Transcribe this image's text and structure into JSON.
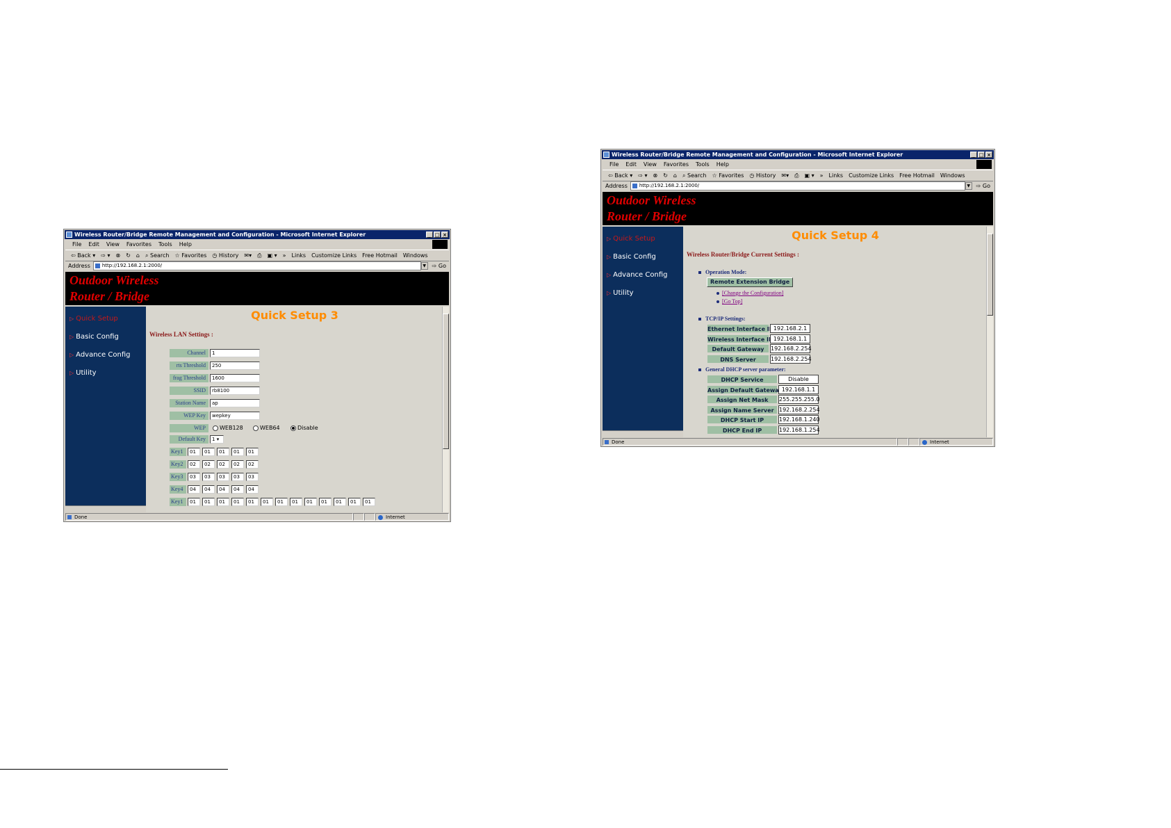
{
  "left_window": {
    "title": "Wireless Router/Bridge Remote Management and Configuration - Microsoft Internet Explorer",
    "menu": [
      "File",
      "Edit",
      "View",
      "Favorites",
      "Tools",
      "Help"
    ],
    "toolbar": [
      "Back",
      "Search",
      "Favorites",
      "History",
      "»",
      "Links",
      "Customize Links",
      "Free Hotmail",
      "Windows"
    ],
    "address_label": "Address",
    "address": "http://192.168.2.1:2000/",
    "go": "Go",
    "banner": [
      "Outdoor Wireless",
      "Router / Bridge"
    ],
    "nav": [
      "Quick Setup",
      "Basic Config",
      "Advance Config",
      "Utility"
    ],
    "page_title": "Quick Setup 3",
    "section": "Wireless LAN Settings :",
    "form": [
      {
        "label": "Channel",
        "value": "1"
      },
      {
        "label": "rts Threshold",
        "value": "250"
      },
      {
        "label": "frag Threshold",
        "value": "1600"
      },
      {
        "label": "SSID",
        "value": "rb8100"
      },
      {
        "label": "Station Name",
        "value": "ap"
      },
      {
        "label": "WEP Key",
        "value": "wepkey"
      }
    ],
    "wep_label": "WEP",
    "wep_options": [
      "WEB128",
      "WEB64",
      "Disable"
    ],
    "wep_selected": "Disable",
    "default_key_label": "Default Key",
    "default_key_value": "1",
    "keys": [
      {
        "label": "Key1",
        "values": [
          "01",
          "01",
          "01",
          "01",
          "01"
        ]
      },
      {
        "label": "Key2",
        "values": [
          "02",
          "02",
          "02",
          "02",
          "02"
        ]
      },
      {
        "label": "Key3",
        "values": [
          "03",
          "03",
          "03",
          "03",
          "03"
        ]
      },
      {
        "label": "Key4",
        "values": [
          "04",
          "04",
          "04",
          "04",
          "04"
        ]
      },
      {
        "label": "Key1",
        "values": [
          "01",
          "01",
          "01",
          "01",
          "01",
          "01",
          "01",
          "01",
          "01",
          "01",
          "01",
          "01",
          "01"
        ]
      }
    ],
    "status": "Done",
    "zone": "Internet"
  },
  "right_window": {
    "title": "Wireless Router/Bridge Remote Management and Configuration - Microsoft Internet Explorer",
    "menu": [
      "File",
      "Edit",
      "View",
      "Favorites",
      "Tools",
      "Help"
    ],
    "toolbar": [
      "Back",
      "Search",
      "Favorites",
      "History",
      "»",
      "Links",
      "Customize Links",
      "Free Hotmail",
      "Windows"
    ],
    "address_label": "Address",
    "address": "http://192.168.2.1:2000/",
    "go": "Go",
    "banner": [
      "Outdoor Wireless",
      "Router / Bridge"
    ],
    "nav": [
      "Quick Setup",
      "Basic Config",
      "Advance Config",
      "Utility"
    ],
    "page_title": "Quick Setup 4",
    "section": "Wireless Router/Bridge Current Settings :",
    "operation_mode_label": "Operation Mode:",
    "operation_mode_value": "Remote Extension Bridge",
    "links": [
      "[Change the Configuration]",
      "[Go Top]"
    ],
    "tcpip_label": "TCP/IP Settings:",
    "tcpip": [
      {
        "label": "Ethernet Interface IP",
        "value": "192.168.2.1"
      },
      {
        "label": "Wireless Interface IP",
        "value": "192.168.1.1"
      },
      {
        "label": "Default Gateway",
        "value": "192.168.2.254"
      },
      {
        "label": "DNS Server",
        "value": "192.168.2.254"
      }
    ],
    "dhcp_label": "General DHCP server parameter:",
    "dhcp": [
      {
        "label": "DHCP Service",
        "value": "Disable"
      },
      {
        "label": "Assign Default Gateway",
        "value": "192.168.1.1"
      },
      {
        "label": "Assign Net Mask",
        "value": "255.255.255.0"
      },
      {
        "label": "Assign Name Server",
        "value": "192.168.2.254"
      },
      {
        "label": "DHCP Start IP",
        "value": "192.168.1.240"
      },
      {
        "label": "DHCP End IP",
        "value": "192.168.1.254"
      }
    ],
    "status": "Done",
    "zone": "Internet"
  }
}
